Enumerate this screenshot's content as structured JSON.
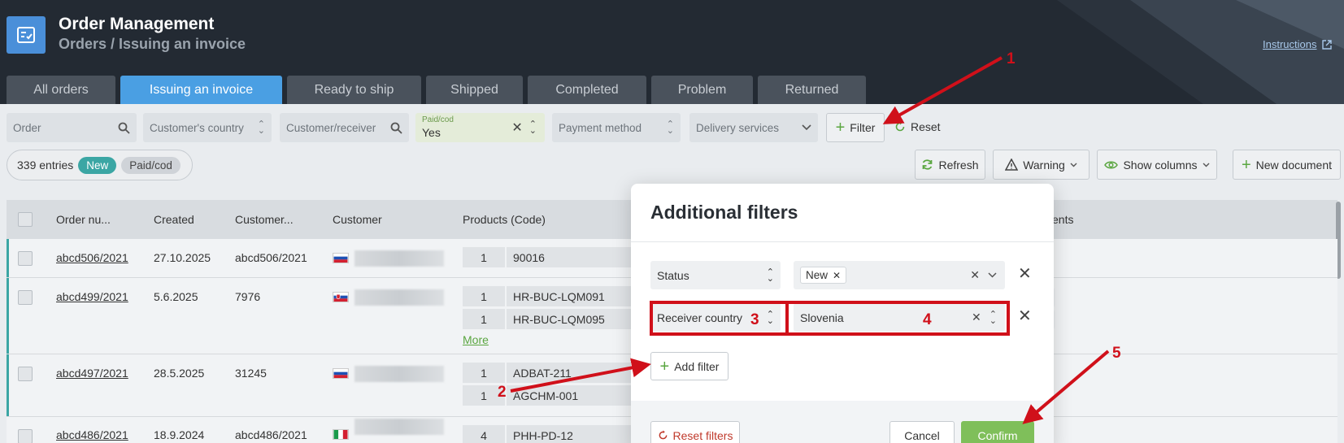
{
  "header": {
    "app_title": "Order Management",
    "breadcrumb": "Orders / Issuing an invoice",
    "instructions": "Instructions",
    "tabs": [
      "All orders",
      "Issuing an invoice",
      "Ready to ship",
      "Shipped",
      "Completed",
      "Problem",
      "Returned"
    ],
    "active_tab": "Issuing an invoice"
  },
  "filters": {
    "order_placeholder": "Order",
    "customer_country": "Customer's country",
    "customer_receiver": "Customer/receiver",
    "paid_cod_label": "Paid/cod",
    "paid_cod_value": "Yes",
    "payment_method": "Payment method",
    "delivery_services": "Delivery services",
    "filter_button": "Filter",
    "reset_button": "Reset"
  },
  "summary": {
    "entries": "339 entries",
    "chips": [
      "New",
      "Paid/cod"
    ]
  },
  "actions": {
    "refresh": "Refresh",
    "warning": "Warning",
    "show_columns": "Show columns",
    "new_document": "New document"
  },
  "table": {
    "columns": [
      "Order nu...",
      "Created",
      "Customer...",
      "Customer",
      "Products (Code)",
      "ents"
    ],
    "rows": [
      {
        "order": "abcd506/2021",
        "created": "27.10.2025",
        "customer_no": "abcd506/2021",
        "flag": "slovenia",
        "products": [
          {
            "qty": "1",
            "code": "90016"
          }
        ],
        "more": ""
      },
      {
        "order": "abcd499/2021",
        "created": "5.6.2025",
        "customer_no": "7976",
        "flag": "slovakia",
        "products": [
          {
            "qty": "1",
            "code": "HR-BUC-LQM091"
          },
          {
            "qty": "1",
            "code": "HR-BUC-LQM095"
          }
        ],
        "more": "More"
      },
      {
        "order": "abcd497/2021",
        "created": "28.5.2025",
        "customer_no": "31245",
        "flag": "slovenia",
        "products": [
          {
            "qty": "1",
            "code": "ADBAT-211"
          },
          {
            "qty": "1",
            "code": "AGCHM-001"
          }
        ],
        "more": ""
      },
      {
        "order": "abcd486/2021",
        "created": "18.9.2024",
        "customer_no": "abcd486/2021",
        "flag": "italy",
        "products": [
          {
            "qty": "4",
            "code": "PHH-PD-12"
          }
        ],
        "more": ""
      }
    ]
  },
  "modal": {
    "title": "Additional filters",
    "filter_rows": [
      {
        "field": "Status",
        "value_tag": "New"
      },
      {
        "field": "Receiver country",
        "value": "Slovenia"
      }
    ],
    "add_filter": "Add filter",
    "reset_filters": "Reset filters",
    "cancel": "Cancel",
    "confirm": "Confirm"
  },
  "annotations": [
    "1",
    "2",
    "3",
    "4",
    "5"
  ],
  "colors": {
    "header_bg": "#232a33",
    "active_tab": "#4a9fe3",
    "teal": "#3ba6a4",
    "confirm_green": "#7fbf5a",
    "annotation_red": "#d0101a"
  }
}
